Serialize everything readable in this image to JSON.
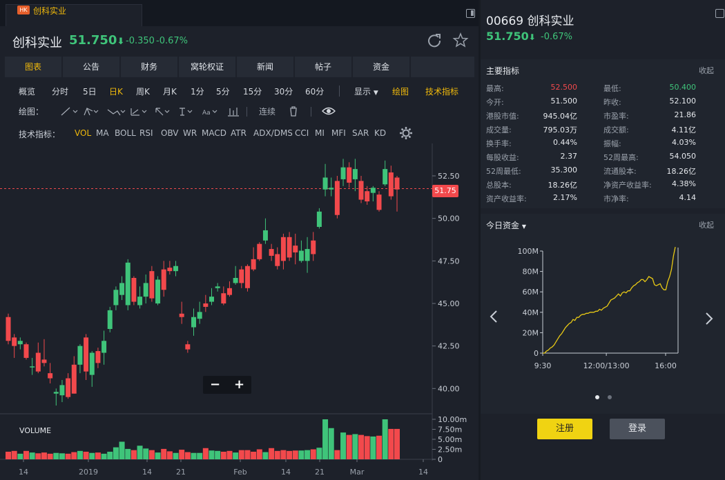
{
  "tab": {
    "badge": "HK",
    "name": "创科实业"
  },
  "header": {
    "name": "创科实业",
    "price": "51.750",
    "change": "-0.350",
    "change_pct": "-0.67%"
  },
  "nav": [
    "图表",
    "公告",
    "财务",
    "窝轮权证",
    "新闻",
    "帖子",
    "资金"
  ],
  "timeframes": [
    "概览",
    "分时",
    "5日",
    "日K",
    "周K",
    "月K",
    "1分",
    "5分",
    "15分",
    "30分",
    "60分",
    "显示",
    "绘图",
    "技术指标"
  ],
  "draw_label": "绘图：",
  "draw_cont": "连续",
  "ind_label": "技术指标：",
  "indicators": [
    "VOL",
    "MA",
    "BOLL",
    "RSI",
    "OBV",
    "WR",
    "MACD",
    "ATR",
    "ADX/DMS",
    "CCI",
    "MI",
    "MFI",
    "SAR",
    "KD"
  ],
  "zoom": {
    "minus": "−",
    "plus": "+"
  },
  "volume_label": "VOLUME",
  "price_tag": "51.75",
  "quote": {
    "code": "00669 创科实业",
    "price": "51.750",
    "change_pct": "-0.67%"
  },
  "metrics_title": "主要指标",
  "collapse": "收起",
  "metrics": [
    [
      "最高:",
      "52.500",
      "最低:",
      "50.400"
    ],
    [
      "今开:",
      "51.500",
      "昨收:",
      "52.100"
    ],
    [
      "港股市值:",
      "945.04亿",
      "市盈率:",
      "21.86"
    ],
    [
      "成交量:",
      "795.03万",
      "成交额:",
      "4.11亿"
    ],
    [
      "换手率:",
      "0.44%",
      "振幅:",
      "4.03%"
    ],
    [
      "每股收益:",
      "2.37",
      "52周最高:",
      "54.050"
    ],
    [
      "52周最低:",
      "35.300",
      "流通股本:",
      "18.26亿"
    ],
    [
      "总股本:",
      "18.26亿",
      "净资产收益率:",
      "4.38%"
    ],
    [
      "资产收益率:",
      "2.17%",
      "市净率:",
      "4.14"
    ]
  ],
  "fund_title": "今日资金",
  "buttons": {
    "register": "注册",
    "login": "登录"
  },
  "colors": {
    "up": "#3fc47a",
    "down": "#f2494c",
    "accent": "#f0b90b"
  },
  "chart_data": [
    {
      "type": "candlestick",
      "title": "",
      "ylim": [
        39,
        54
      ],
      "y_ticks": [
        "52.50",
        "50.00",
        "47.50",
        "45.00",
        "42.50",
        "40.00"
      ],
      "y_tick_values": [
        52.5,
        50,
        47.5,
        45,
        42.5,
        40
      ],
      "x_ticks": [
        "14",
        "2019",
        "14",
        "21",
        "Feb",
        "14",
        "21",
        "Mar",
        "14"
      ],
      "last_price": 51.75,
      "candles": [
        [
          44.2,
          42.8,
          44.4,
          42.6
        ],
        [
          43.0,
          42.5,
          43.2,
          41.8
        ],
        [
          42.6,
          42.8,
          43.0,
          42.3
        ],
        [
          42.6,
          41.8,
          42.7,
          41.7
        ],
        [
          41.3,
          41.3,
          41.8,
          40.8
        ],
        [
          42.1,
          41.0,
          42.7,
          40.9
        ],
        [
          41.7,
          41.5,
          42.9,
          41.3
        ],
        [
          40.9,
          40.6,
          41.5,
          40.3
        ],
        [
          39.7,
          39.8,
          40.0,
          39.0
        ],
        [
          39.6,
          40.2,
          40.5,
          39.2
        ],
        [
          40.6,
          39.5,
          40.9,
          39.4
        ],
        [
          41.4,
          39.7,
          41.9,
          39.7
        ],
        [
          41.4,
          42.5,
          42.6,
          40.9
        ],
        [
          43.0,
          41.0,
          43.2,
          40.5
        ],
        [
          40.8,
          42.1,
          42.2,
          40.1
        ],
        [
          42.2,
          41.5,
          42.4,
          41.2
        ],
        [
          42.1,
          42.8,
          43.4,
          41.4
        ],
        [
          43.5,
          44.6,
          44.8,
          43.3
        ],
        [
          44.9,
          45.8,
          46.0,
          44.6
        ],
        [
          45.5,
          46.2,
          46.6,
          45.2
        ],
        [
          44.9,
          47.4,
          47.6,
          44.6
        ],
        [
          46.5,
          45.1,
          46.6,
          44.9
        ],
        [
          44.9,
          45.4,
          46.0,
          44.7
        ],
        [
          45.4,
          46.2,
          46.7,
          45.0
        ],
        [
          46.9,
          45.3,
          47.2,
          45.1
        ],
        [
          45.0,
          46.4,
          46.6,
          44.9
        ],
        [
          47.0,
          45.8,
          47.5,
          45.4
        ],
        [
          47.1,
          46.9,
          47.5,
          46.7
        ],
        [
          46.9,
          47.2,
          47.5,
          46.6
        ],
        [
          44.4,
          44.2,
          45.1,
          43.8
        ],
        [
          42.6,
          42.3,
          42.8,
          42.1
        ],
        [
          43.6,
          44.2,
          44.7,
          43.1
        ],
        [
          44.1,
          44.5,
          45.1,
          43.8
        ],
        [
          45.0,
          44.8,
          45.5,
          44.5
        ],
        [
          45.1,
          45.4,
          45.9,
          44.9
        ],
        [
          45.9,
          46.0,
          46.2,
          45.7
        ],
        [
          45.6,
          45.0,
          46.0,
          44.9
        ],
        [
          45.9,
          45.5,
          46.3,
          45.4
        ],
        [
          46.2,
          46.5,
          47.2,
          46.1
        ],
        [
          47.0,
          46.2,
          47.2,
          45.9
        ],
        [
          47.2,
          45.9,
          47.3,
          45.7
        ],
        [
          47.6,
          47.0,
          48.3,
          46.9
        ],
        [
          48.5,
          47.6,
          48.6,
          47.5
        ],
        [
          48.7,
          49.3,
          50.0,
          48.5
        ],
        [
          48.2,
          47.8,
          48.5,
          47.5
        ],
        [
          47.9,
          47.2,
          48.3,
          47.0
        ],
        [
          48.9,
          47.5,
          49.1,
          47.0
        ],
        [
          48.9,
          47.7,
          49.2,
          47.5
        ],
        [
          48.4,
          48.0,
          49.1,
          47.3
        ],
        [
          47.5,
          48.1,
          48.7,
          47.4
        ],
        [
          47.5,
          48.2,
          48.9,
          46.8
        ],
        [
          48.7,
          47.9,
          49.2,
          47.5
        ],
        [
          49.5,
          50.4,
          50.6,
          49.4
        ],
        [
          51.7,
          52.4,
          53.2,
          51.3
        ],
        [
          51.7,
          51.8,
          52.4,
          51.3
        ],
        [
          52.2,
          50.2,
          52.5,
          50.0
        ],
        [
          52.3,
          53.0,
          53.5,
          51.9
        ],
        [
          53.0,
          52.1,
          53.3,
          51.8
        ],
        [
          52.3,
          52.9,
          53.5,
          51.6
        ],
        [
          52.2,
          51.1,
          52.5,
          50.9
        ],
        [
          51.6,
          51.0,
          51.9,
          50.8
        ],
        [
          51.5,
          51.8,
          51.9,
          51.0
        ],
        [
          51.4,
          50.5,
          51.6,
          50.4
        ],
        [
          52.0,
          52.9,
          53.4,
          51.9
        ],
        [
          52.7,
          51.3,
          53.1,
          51.1
        ],
        [
          52.4,
          51.7,
          52.5,
          50.4
        ]
      ]
    },
    {
      "type": "bar",
      "title": "VOLUME",
      "ylim": [
        0,
        10000000
      ],
      "y_ticks": [
        "10.00m",
        "7.50m",
        "5.00m",
        "2.50m",
        "0"
      ],
      "values": [
        1.9,
        2.1,
        1.4,
        2.1,
        1.7,
        1.5,
        1.7,
        1.4,
        1.6,
        1.5,
        1.4,
        1.8,
        2.1,
        1.9,
        1.6,
        1.7,
        1.4,
        1.9,
        3.0,
        4.4,
        2.6,
        2.3,
        3.4,
        2.7,
        2.3,
        1.7,
        2.6,
        2.0,
        1.6,
        2.4,
        1.8,
        1.6,
        1.6,
        2.8,
        2.2,
        2.1,
        1.9,
        2.1,
        1.7,
        2.3,
        2.3,
        1.9,
        2.5,
        1.8,
        2.8,
        2.1,
        2.3,
        2.1,
        2.2,
        2.2,
        2.3,
        2.5,
        2.9,
        10.0,
        7.8,
        2.3,
        6.7,
        6.1,
        6.3,
        6.1,
        5.8,
        5.7,
        5.9,
        10.0,
        7.6,
        7.6
      ],
      "colors_up": "#3fc47a",
      "colors_down": "#f2494c"
    },
    {
      "type": "line",
      "title": "今日资金",
      "x_ticks": [
        "9:30",
        "12:00/13:00",
        "16:00"
      ],
      "y_ticks": [
        "100M",
        "80M",
        "60M",
        "40M",
        "20M",
        "0"
      ],
      "ylim": [
        0,
        105
      ],
      "values": [
        0,
        0,
        2,
        3,
        5,
        6,
        8,
        11,
        14,
        17,
        19,
        22,
        25,
        27,
        29,
        30,
        33,
        32,
        35,
        35,
        37,
        38,
        38,
        39,
        39,
        40,
        40,
        40,
        41,
        41,
        43,
        42,
        44,
        45,
        46,
        49,
        52,
        53,
        54,
        56,
        58,
        56,
        59,
        60,
        59,
        61,
        61,
        64,
        66,
        67,
        69,
        70,
        72,
        72,
        70,
        72,
        75,
        74,
        73,
        67,
        66,
        67,
        68,
        64,
        62,
        62,
        70,
        75,
        82,
        95,
        104
      ]
    }
  ]
}
